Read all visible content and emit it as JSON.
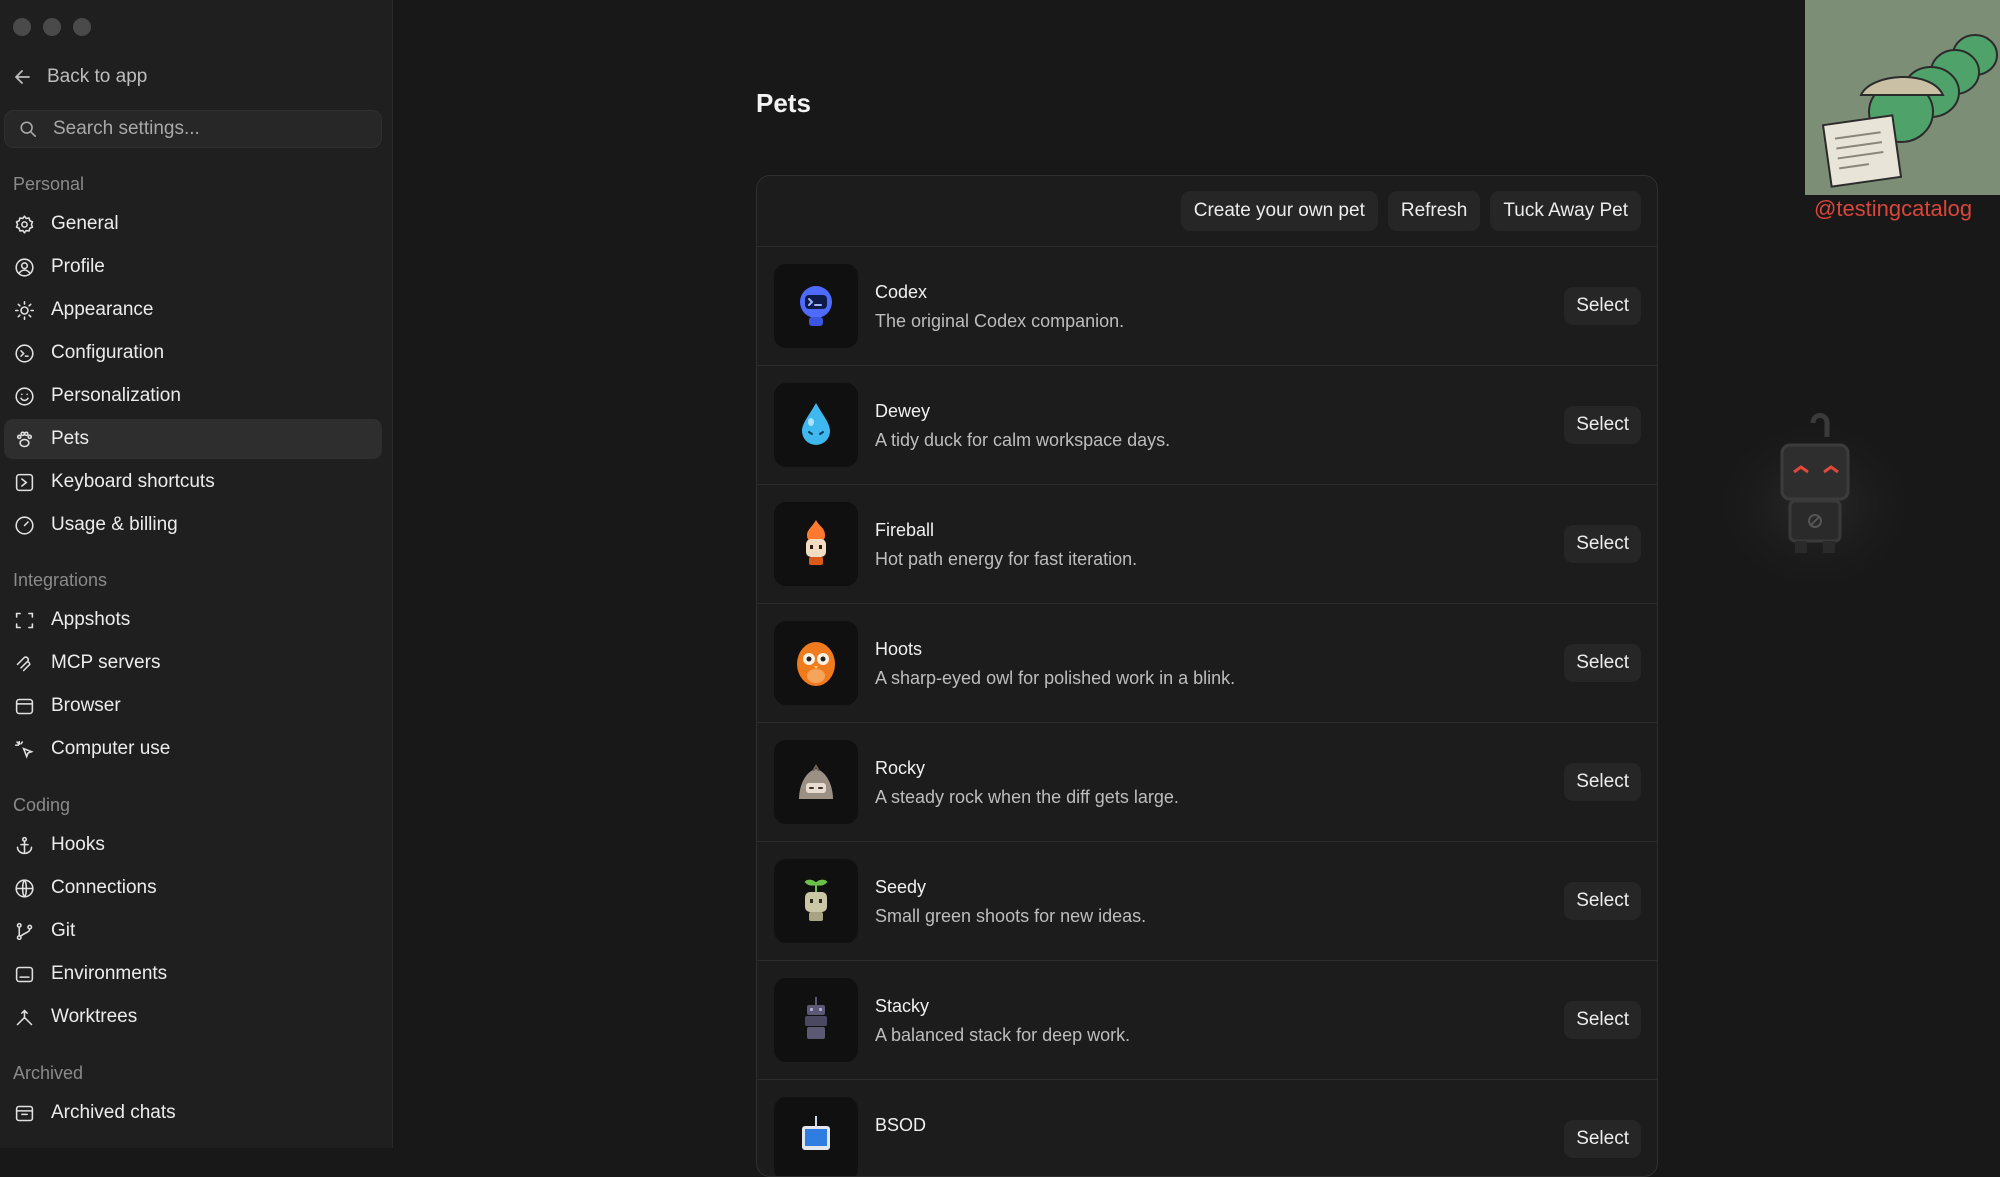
{
  "sidebar": {
    "back_label": "Back to app",
    "search_placeholder": "Search settings...",
    "sections": {
      "personal": "Personal",
      "integrations": "Integrations",
      "coding": "Coding",
      "archived": "Archived"
    },
    "items": {
      "general": "General",
      "profile": "Profile",
      "appearance": "Appearance",
      "configuration": "Configuration",
      "personalization": "Personalization",
      "pets": "Pets",
      "keyboard_shortcuts": "Keyboard shortcuts",
      "usage_billing": "Usage & billing",
      "appshots": "Appshots",
      "mcp_servers": "MCP servers",
      "browser": "Browser",
      "computer_use": "Computer use",
      "hooks": "Hooks",
      "connections": "Connections",
      "git": "Git",
      "environments": "Environments",
      "worktrees": "Worktrees",
      "archived_chats": "Archived chats"
    },
    "active_item": "pets"
  },
  "main": {
    "title": "Pets",
    "toolbar": {
      "create_label": "Create your own pet",
      "refresh_label": "Refresh",
      "tuck_label": "Tuck Away Pet"
    },
    "select_label": "Select",
    "pets": [
      {
        "name": "Codex",
        "description": "The original Codex companion.",
        "icon": "codex-robot-icon",
        "color": "#4f6bff"
      },
      {
        "name": "Dewey",
        "description": "A tidy duck for calm workspace days.",
        "icon": "water-drop-icon",
        "color": "#3fb8f0"
      },
      {
        "name": "Fireball",
        "description": "Hot path energy for fast iteration.",
        "icon": "fireball-icon",
        "color": "#ff7a2e"
      },
      {
        "name": "Hoots",
        "description": "A sharp-eyed owl for polished work in a blink.",
        "icon": "owl-icon",
        "color": "#f07a1e"
      },
      {
        "name": "Rocky",
        "description": "A steady rock when the diff gets large.",
        "icon": "rock-icon",
        "color": "#9c8f84"
      },
      {
        "name": "Seedy",
        "description": "Small green shoots for new ideas.",
        "icon": "seedling-icon",
        "color": "#c9c7a5"
      },
      {
        "name": "Stacky",
        "description": "A balanced stack for deep work.",
        "icon": "stack-robot-icon",
        "color": "#5a5872"
      },
      {
        "name": "BSOD",
        "description": "",
        "icon": "bsod-monitor-icon",
        "color": "#2f7de0"
      }
    ]
  },
  "overlay": {
    "watermark": "@testingcatalog",
    "watermark_color": "#d9463a"
  }
}
